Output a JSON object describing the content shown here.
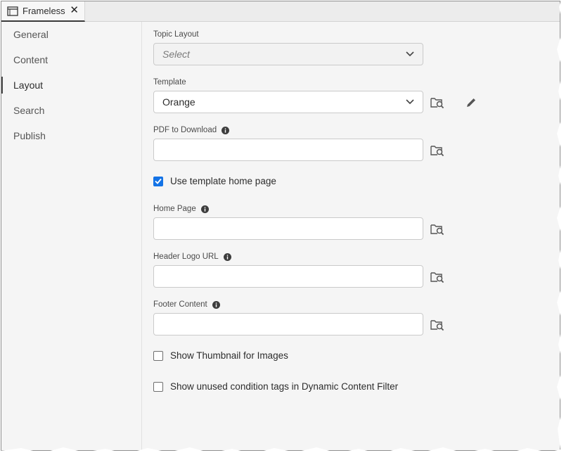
{
  "tab": {
    "title": "Frameless",
    "close_glyph": "✕"
  },
  "sidebar": {
    "items": [
      {
        "label": "General",
        "active": false
      },
      {
        "label": "Content",
        "active": false
      },
      {
        "label": "Layout",
        "active": true
      },
      {
        "label": "Search",
        "active": false
      },
      {
        "label": "Publish",
        "active": false
      }
    ]
  },
  "form": {
    "topic_layout": {
      "label": "Topic Layout",
      "value": "",
      "placeholder": "Select"
    },
    "template": {
      "label": "Template",
      "value": "Orange"
    },
    "pdf_download": {
      "label": "PDF to Download",
      "value": ""
    },
    "use_template_home": {
      "label": "Use template home page",
      "checked": true
    },
    "home_page": {
      "label": "Home Page",
      "value": ""
    },
    "header_logo_url": {
      "label": "Header Logo URL",
      "value": ""
    },
    "footer_content": {
      "label": "Footer Content",
      "value": ""
    },
    "show_thumbnail": {
      "label": "Show Thumbnail for Images",
      "checked": false
    },
    "show_unused_tags": {
      "label": "Show unused condition tags in Dynamic Content Filter",
      "checked": false
    }
  },
  "colors": {
    "accent": "#1473e6",
    "panel_bg": "#f5f5f5",
    "field_border": "#cacaca"
  },
  "icons": [
    "window-icon",
    "close-icon",
    "chevron-down-icon",
    "browse-folder-icon",
    "pencil-icon",
    "info-icon",
    "checkmark-icon"
  ]
}
